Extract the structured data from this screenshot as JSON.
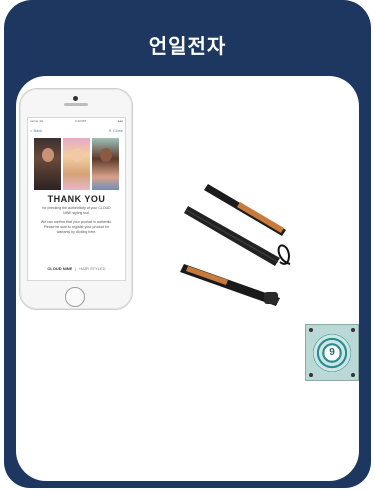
{
  "header": {
    "title": "언일전자"
  },
  "phone_screen": {
    "carrier": "carrier 4G",
    "time": "3:43 PM",
    "battery": "●●●",
    "nav_back": "< Back",
    "nav_close": "✕ Close",
    "heading": "THANK YOU",
    "message_1": "for checking the authenticity of your CLOUD NINE styling tool.",
    "message_2": "We can confirm that your product is authentic. Please be sure to register your product for warranty by clicking here.",
    "brand": "CLOUD NINE",
    "brand_tagline": "HAIR STYLED"
  },
  "hologram": {
    "number": "9"
  },
  "colors": {
    "card_bg": "#1d3760",
    "panel_bg": "#ffffff",
    "accent_teal": "#2b8d91",
    "plate_copper": "#c87a3c"
  }
}
